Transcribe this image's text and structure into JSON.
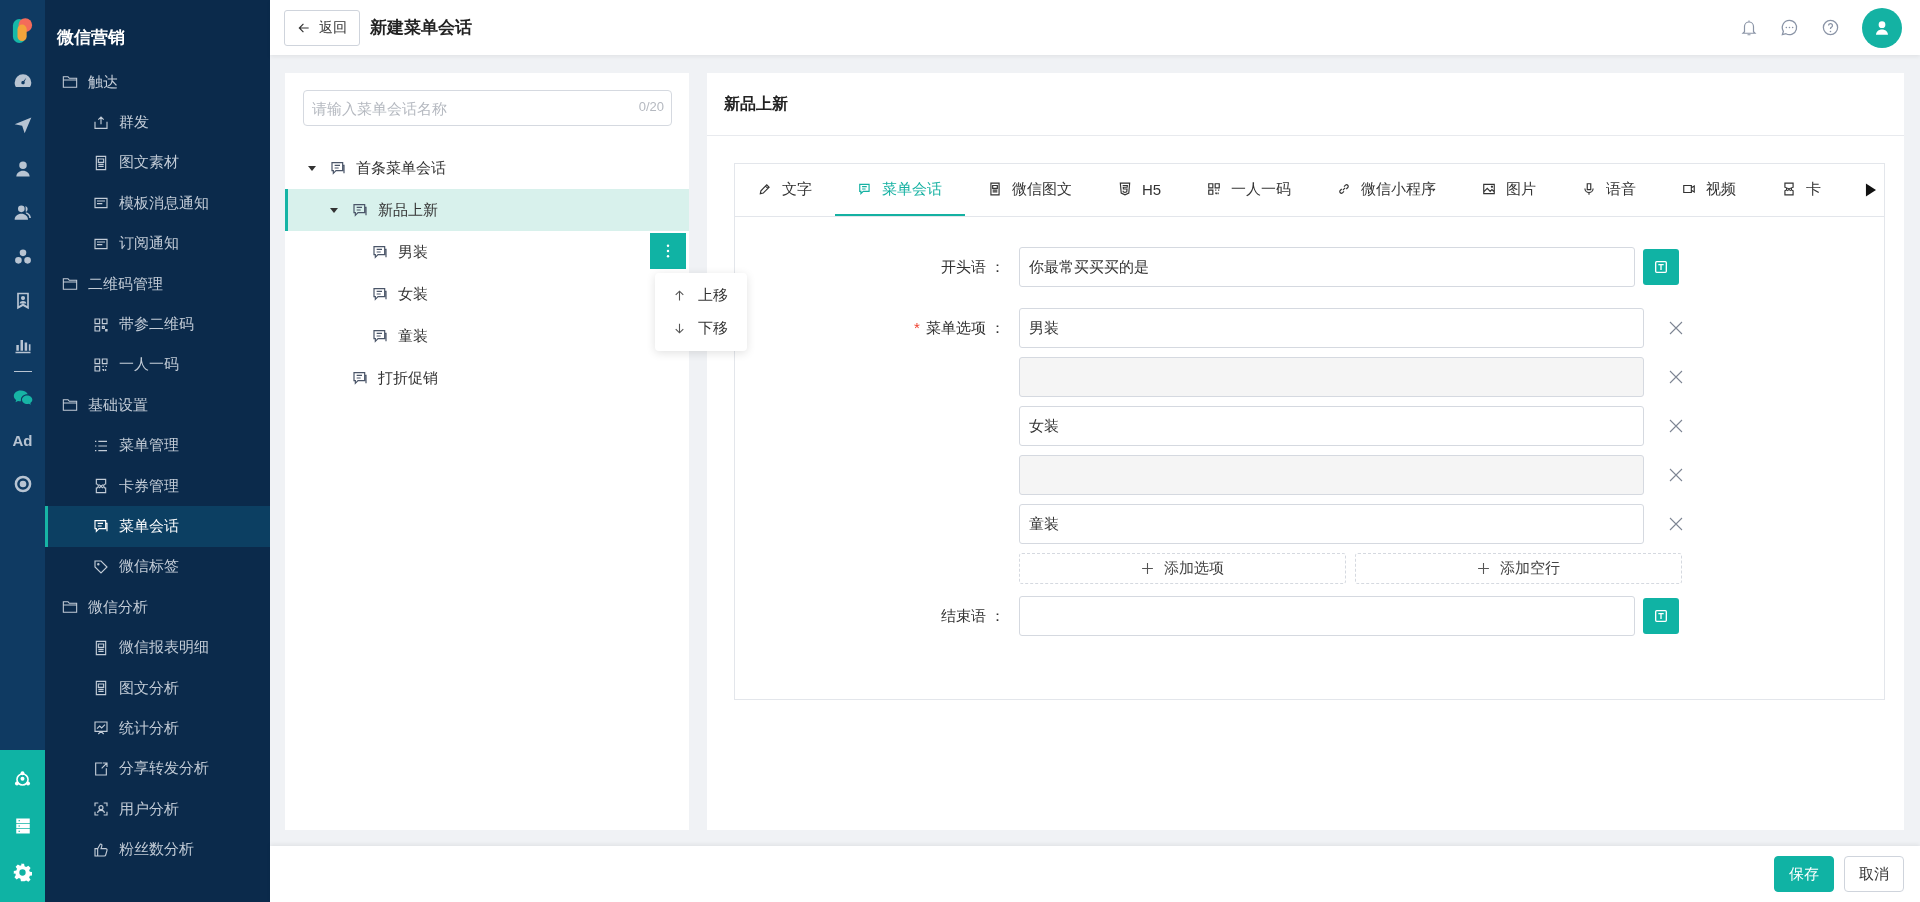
{
  "rail": {
    "items": [
      {
        "selected": false
      },
      {
        "selected": false
      },
      {
        "selected": false
      },
      {
        "selected": false
      },
      {
        "selected": false
      },
      {
        "selected": false
      },
      {
        "selected": false
      },
      {
        "selected": true
      },
      {
        "label": "Ad",
        "selected": false
      },
      {
        "selected": false
      }
    ]
  },
  "sidebar": {
    "title": "微信营销",
    "groups": [
      {
        "label": "触达",
        "items": [
          {
            "label": "群发",
            "selected": false
          },
          {
            "label": "图文素材",
            "selected": false
          },
          {
            "label": "模板消息通知",
            "selected": false
          },
          {
            "label": "订阅通知",
            "selected": false
          }
        ]
      },
      {
        "label": "二维码管理",
        "items": [
          {
            "label": "带参二维码",
            "selected": false
          },
          {
            "label": "一人一码",
            "selected": false
          }
        ]
      },
      {
        "label": "基础设置",
        "items": [
          {
            "label": "菜单管理",
            "selected": false
          },
          {
            "label": "卡券管理",
            "selected": false
          },
          {
            "label": "菜单会话",
            "selected": true
          },
          {
            "label": "微信标签",
            "selected": false
          }
        ]
      },
      {
        "label": "微信分析",
        "items": [
          {
            "label": "微信报表明细",
            "selected": false
          },
          {
            "label": "图文分析",
            "selected": false
          },
          {
            "label": "统计分析",
            "selected": false
          },
          {
            "label": "分享转发分析",
            "selected": false
          },
          {
            "label": "用户分析",
            "selected": false
          },
          {
            "label": "粉丝数分析",
            "selected": false
          }
        ]
      }
    ]
  },
  "header": {
    "back": "返回",
    "title": "新建菜单会话"
  },
  "tree_panel": {
    "search": {
      "placeholder": "请输入菜单会话名称",
      "counter": "0/20"
    },
    "nodes": [
      {
        "label": "首条菜单会话",
        "expanded": true,
        "selected": false,
        "children": [
          {
            "label": "新品上新",
            "expanded": true,
            "selected": true,
            "children": [
              {
                "label": "男装",
                "selected": false,
                "actions_open": true
              },
              {
                "label": "女装",
                "selected": false,
                "actions_open": false
              },
              {
                "label": "童装",
                "selected": false,
                "actions_open": false
              }
            ]
          },
          {
            "label": "打折促销",
            "selected": false
          }
        ]
      }
    ],
    "context_menu": [
      {
        "label": "上移",
        "kind": "up"
      },
      {
        "label": "下移",
        "kind": "down"
      }
    ]
  },
  "editor": {
    "title": "新品上新",
    "tabs": [
      {
        "label": "文字",
        "selected": false
      },
      {
        "label": "菜单会话",
        "selected": true
      },
      {
        "label": "微信图文",
        "selected": false
      },
      {
        "label": "H5",
        "selected": false
      },
      {
        "label": "一人一码",
        "selected": false
      },
      {
        "label": "微信小程序",
        "selected": false
      },
      {
        "label": "图片",
        "selected": false
      },
      {
        "label": "语音",
        "selected": false
      },
      {
        "label": "视频",
        "selected": false
      },
      {
        "label": "卡",
        "selected": false
      }
    ],
    "opening": {
      "label": "开头语 ：",
      "value": "你最常买买买的是"
    },
    "options": {
      "label": "菜单选项 ：",
      "required_mark": "*",
      "items": [
        {
          "kind": "text",
          "value": "男装"
        },
        {
          "kind": "blank"
        },
        {
          "kind": "text",
          "value": "女装"
        },
        {
          "kind": "blank"
        },
        {
          "kind": "text",
          "value": "童装"
        }
      ],
      "add_buttons": [
        "添加选项",
        "添加空行"
      ]
    },
    "closing": {
      "label": "结束语 ："
    }
  },
  "footer": {
    "buttons": [
      {
        "label": "保存",
        "kind": "primary"
      },
      {
        "label": "取消",
        "kind": "default"
      }
    ]
  }
}
